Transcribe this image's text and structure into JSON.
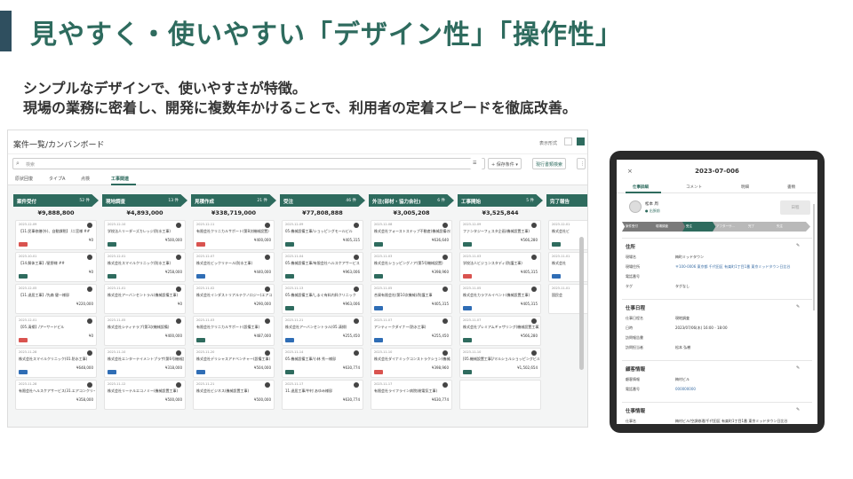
{
  "slide": {
    "title": "見やすく・使いやすい「デザイン性」「操作性」",
    "subtitle_line1": "シンプルなデザインで、使いやすさが特徴。",
    "subtitle_line2": "現場の業務に密着し、開発に複数年かけることで、利用者の定着スピードを徹底改善。"
  },
  "desktop": {
    "page_title": "案件一覧/カンバンボード",
    "view_label": "表示形式",
    "search_placeholder": "検索",
    "save_condition_label": "+ 保存条件 ▾",
    "export_label": "現行書類検索",
    "tabs": [
      "原状回復",
      "タイプA",
      "点検",
      "工事関連"
    ],
    "columns": [
      {
        "name": "案件受付",
        "count": "52 件",
        "total": "¥9,888,800",
        "cards": [
          {
            "date": "2023-12-09",
            "name": "【11.民事修繕(外)、自動課税】 /二宮様 ##",
            "amount": "¥0",
            "badge_color": "#d9534f"
          },
          {
            "date": "2023-10-01",
            "name": "【14.解体工事】/星野様 ##",
            "amount": "¥0",
            "badge_color": "#2e6b5e"
          },
          {
            "date": "2023-12-05",
            "name": "【11.退居工事】/先森 健一様邸",
            "amount": "¥220,000",
            "badge_color": ""
          },
          {
            "date": "2023-12-01",
            "name": "【05.清掃】/アーサードビル",
            "amount": "¥0",
            "badge_color": "#d9534f"
          },
          {
            "date": "2023-11-28",
            "name": "株式会社スマイルクリニック(01.防水工事)",
            "amount": "¥648,000",
            "badge_color": "#2f6db5"
          },
          {
            "date": "2023-11-28",
            "name": "有限会社ヘルスケアサービス(31.エアコンクリーニング)",
            "amount": "¥358,000",
            "badge_color": ""
          }
        ]
      },
      {
        "name": "現地調査",
        "count": "13 件",
        "total": "¥4,893,000",
        "cards": [
          {
            "date": "2023-12-10",
            "name": "学校法人リーダーズカレッジ(防水工事)",
            "amount": "¥500,000",
            "badge_color": "#2e6b5e"
          },
          {
            "date": "2023-12-01",
            "name": "株式会社スマイルクリニック(防水工事)",
            "amount": "¥258,000",
            "badge_color": "#2e6b5e"
          },
          {
            "date": "2023-11-01",
            "name": "株式会社アーバンセントラル(機械設備工事)",
            "amount": "¥0",
            "badge_color": ""
          },
          {
            "date": "2023-11-05",
            "name": "株式会社シティテラプ(第3次機械設備)",
            "amount": "¥400,000",
            "badge_color": ""
          },
          {
            "date": "2023-11-10",
            "name": "株式会社エンターテイメントプラザ(第6号機械設置)",
            "amount": "¥318,000",
            "badge_color": "#2f6db5"
          },
          {
            "date": "2023-11-12",
            "name": "株式会社リーテルエコノミー(機械設置工事)",
            "amount": "¥500,000",
            "badge_color": ""
          }
        ]
      },
      {
        "name": "見積作成",
        "count": "21 件",
        "total": "¥338,719,000",
        "cards": [
          {
            "date": "2023-12-11",
            "name": "有限会社クリニカルサポート(第8次機械設置)",
            "amount": "¥400,000",
            "badge_color": "#d9534f"
          },
          {
            "date": "2023-12-07",
            "name": "株式会社ビックリテール(防水工事)",
            "amount": "¥440,000",
            "badge_color": "#2f6db5"
          },
          {
            "date": "2023-11-02",
            "name": "株式会社インダストリアルテクノロジー(エアコンクリーニング)",
            "amount": "¥290,000",
            "badge_color": ""
          },
          {
            "date": "2023-11-03",
            "name": "有限会社クリニカルサポート(設備工事)",
            "amount": "¥487,000",
            "badge_color": "#2e6b5e"
          },
          {
            "date": "2023-11-20",
            "name": "株式会社デリシャスアドベンチャー(設備工事)",
            "amount": "¥504,000",
            "badge_color": "#2f6db5"
          },
          {
            "date": "2023-11-21",
            "name": "株式会社ビジネス(機械設置工事)",
            "amount": "¥500,000",
            "badge_color": ""
          }
        ]
      },
      {
        "name": "受注",
        "count": "46 件",
        "total": "¥77,808,888",
        "cards": [
          {
            "date": "2023-12-09",
            "name": "05.機械設備工事/ショッピングモールビル",
            "amount": "¥405,315",
            "badge_color": "#2e6b5e"
          },
          {
            "date": "2023-11-04",
            "name": "05.機械設備工事/有限会社ヘルスケアサービス",
            "amount": "¥963,006",
            "badge_color": "#2e6b5e"
          },
          {
            "date": "2023-11-13",
            "name": "05.機械設備工事/しまぐ有料内科クリニック",
            "amount": "¥963,006",
            "badge_color": "#2e6b5e"
          },
          {
            "date": "2023-11-21",
            "name": "株式会社アーバンセントラル(05.清掃)",
            "amount": "¥255,450",
            "badge_color": "#2f6db5"
          },
          {
            "date": "2023-11-14",
            "name": "05.機械設備工事/小林 秀一様邸",
            "amount": "¥630,774",
            "badge_color": "#2e6b5e"
          },
          {
            "date": "2023-11-17",
            "name": "11.退居工事/中村 あゆみ様邸",
            "amount": "¥630,774",
            "badge_color": ""
          }
        ]
      },
      {
        "name": "外注(部材・協力会社)",
        "count": "6 件",
        "total": "¥3,005,208",
        "cards": [
          {
            "date": "2023-12-08",
            "name": "株式会社フォーストステップ不動産(機械設備の販売)",
            "amount": "¥636,640",
            "badge_color": "#2e6b5e"
          },
          {
            "date": "2023-11-03",
            "name": "株式会社ショッピングノア(第5号機械設置)",
            "amount": "¥398,960",
            "badge_color": "#2e6b5e"
          },
          {
            "date": "2023-11-05",
            "name": "合資有限会社(第10次機械)/防護工事",
            "amount": "¥405,315",
            "badge_color": "#2f6db5"
          },
          {
            "date": "2023-11-07",
            "name": "アンティークダイナー(防水工事)",
            "amount": "¥255,450",
            "badge_color": "#2f6db5"
          },
          {
            "date": "2023-11-10",
            "name": "株式会社ダイナミックコンストラクション(機械設置工事)",
            "amount": "¥398,960",
            "badge_color": "#d9534f"
          },
          {
            "date": "2023-11-17",
            "name": "有限会社ライフライン病院(総電気工事)",
            "amount": "¥630,774",
            "badge_color": ""
          }
        ]
      },
      {
        "name": "工事開始",
        "count": "5 件",
        "total": "¥3,525,844",
        "cards": [
          {
            "date": "2023-12-09",
            "name": "ファンタジーフェスタ企画(機械設置工事)",
            "amount": "¥566,280",
            "badge_color": "#2e6b5e"
          },
          {
            "date": "2023-11-03",
            "name": "学校法人ビジョンスタディ(防護工事)",
            "amount": "¥405,315",
            "badge_color": "#d9534f"
          },
          {
            "date": "2023-11-05",
            "name": "株式会社カラフルイベント(機械設置工事)",
            "amount": "¥405,315",
            "badge_color": "#2f6db5"
          },
          {
            "date": "2023-11-07",
            "name": "株式会社プレミアムギャザリング(機械設置工事)",
            "amount": "¥566,280",
            "badge_color": "#2e6b5e"
          },
          {
            "date": "2023-11-10",
            "name": "[05.機械設置工事]/マルショルショッピングビル",
            "amount": "¥1,502,654",
            "badge_color": "#2e6b5e"
          },
          {
            "date": "",
            "name": "",
            "amount": "",
            "badge_color": ""
          }
        ]
      },
      {
        "name": "完了報告",
        "count": "",
        "total": "",
        "cards": [
          {
            "date": "2023-12-01",
            "name": "株式会社ビ",
            "amount": "",
            "badge_color": "#2e6b5e"
          },
          {
            "date": "2023-11-01",
            "name": "株式会社",
            "amount": "",
            "badge_color": "#2f6db5"
          },
          {
            "date": "2023-11-01",
            "name": "国民会",
            "amount": "",
            "badge_color": ""
          }
        ]
      }
    ]
  },
  "tablet": {
    "close_icon": "×",
    "case_id": "2023-07-006",
    "tabs": [
      "仕事詳細",
      "コメント",
      "明細",
      "書類"
    ],
    "person_name": "松本 周",
    "person_status": "● 出張前",
    "action_button": "日程",
    "steps": [
      "案件受付",
      "現場調査",
      "受注",
      "アフターサ…",
      "完了",
      "失注"
    ],
    "sections": {
      "address": {
        "title": "住所",
        "rows": [
          {
            "k": "現場名",
            "v": "梅町ミッドタウン",
            "link": false
          },
          {
            "k": "現場住所",
            "v": "〒100-0006 東京都 千代田区 有楽町1丁目1番 東京ミッドタウン日比谷",
            "link": true
          },
          {
            "k": "電話番号",
            "v": "",
            "link": false
          },
          {
            "k": "タグ",
            "v": "タグなし",
            "link": false
          }
        ]
      },
      "work": {
        "title": "仕事日程",
        "rows": [
          {
            "k": "仕事日程名",
            "v": "現地調査",
            "link": false
          },
          {
            "k": "日時",
            "v": "2023/07/06(木) 16:00 - 18:00",
            "link": false
          },
          {
            "k": "訪問報告書",
            "v": "",
            "link": false
          },
          {
            "k": "訪問担当者",
            "v": "松本 弘樹",
            "link": false
          }
        ]
      },
      "customer": {
        "title": "顧客情報",
        "rows": [
          {
            "k": "顧客情報",
            "v": "梅村ビル",
            "link": false
          },
          {
            "k": "電話番号",
            "v": "000000000",
            "link": true
          }
        ]
      },
      "job": {
        "title": "仕事情報",
        "rows": [
          {
            "k": "仕事名",
            "v": "梅村ビル/空調修理/千代田区 有楽町1丁目1番 東京ミッドタウン日比谷",
            "link": false
          },
          {
            "k": "仕事タイプ",
            "v": "空調修理",
            "link": false
          }
        ]
      }
    }
  }
}
